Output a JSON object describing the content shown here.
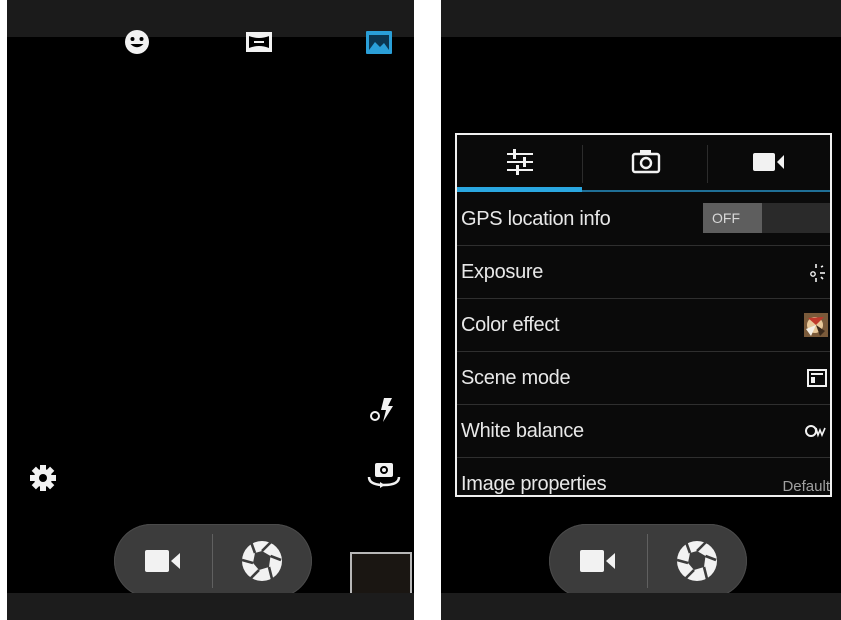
{
  "left_screen": {
    "mode_icons": [
      "face-icon",
      "panorama-icon",
      "photo-icon"
    ],
    "accent": "#2a9fd8",
    "controls": [
      "flash-auto-icon",
      "switch-camera-icon",
      "settings-gear-icon"
    ],
    "shutter": {
      "video": "video-camera-icon",
      "photo": "aperture-icon"
    }
  },
  "right_screen": {
    "tabs": [
      "sliders-icon",
      "camera-icon",
      "video-camera-icon"
    ],
    "active_tab": 0,
    "settings": [
      {
        "label": "GPS location info",
        "toggle": "OFF"
      },
      {
        "label": "Exposure",
        "icon": "exposure-icon"
      },
      {
        "label": "Color effect",
        "icon": "color-effect-icon"
      },
      {
        "label": "Scene mode",
        "icon": "scene-mode-icon"
      },
      {
        "label": "White balance",
        "icon": "white-balance-auto-icon"
      },
      {
        "label": "Image properties",
        "value": "Default"
      }
    ]
  }
}
